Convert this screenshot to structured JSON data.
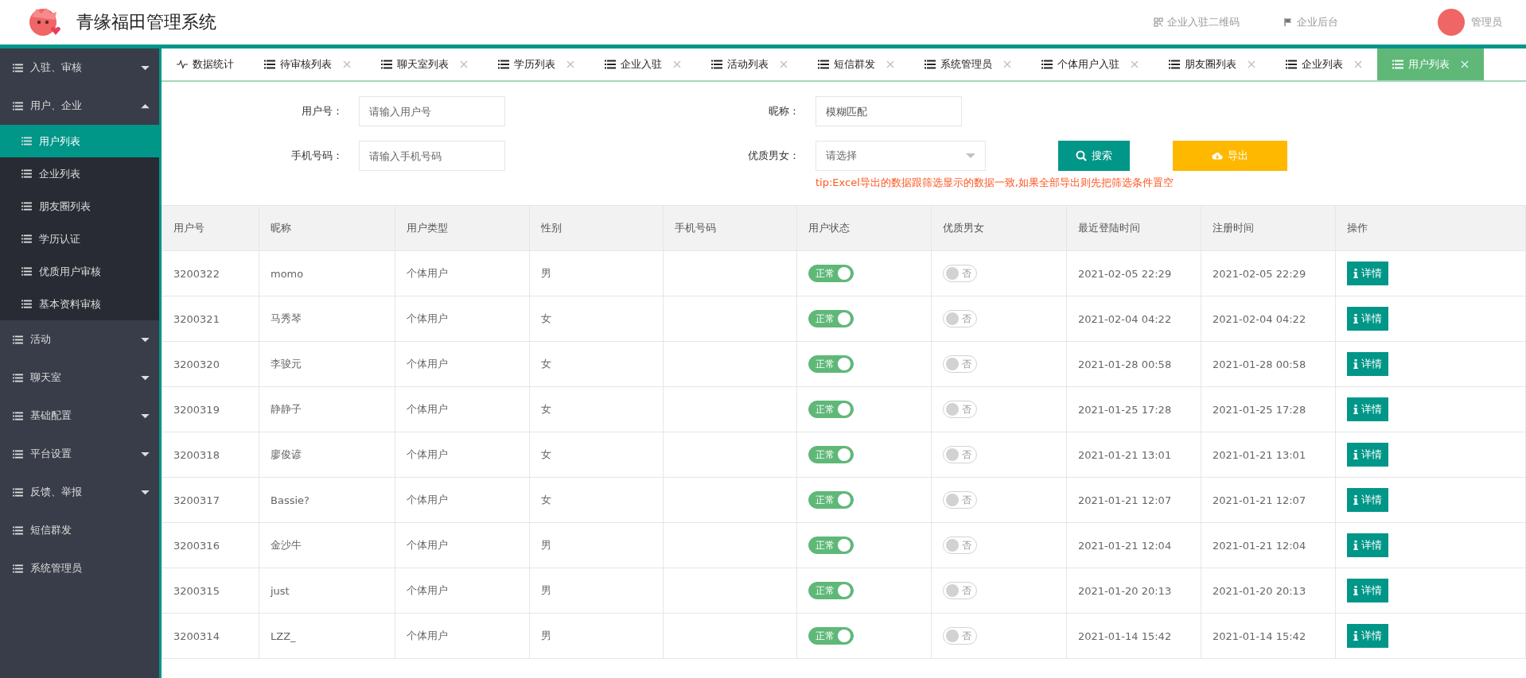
{
  "header": {
    "title": "青缘福田管理系统",
    "links": [
      {
        "kind": "qrcode",
        "label": "企业入驻二维码"
      },
      {
        "kind": "flag",
        "label": "企业后台"
      }
    ],
    "user": "管理员"
  },
  "sidebar": {
    "items": [
      {
        "label": "入驻、审核",
        "kind": "group",
        "expanded": false
      },
      {
        "label": "用户、企业",
        "kind": "group",
        "expanded": true,
        "children": [
          {
            "label": "用户列表",
            "selected": true
          },
          {
            "label": "企业列表",
            "selected": false
          },
          {
            "label": "朋友圈列表",
            "selected": false
          },
          {
            "label": "学历认证",
            "selected": false
          },
          {
            "label": "优质用户审核",
            "selected": false
          },
          {
            "label": "基本资料审核",
            "selected": false
          }
        ]
      },
      {
        "label": "活动",
        "kind": "group",
        "expanded": false
      },
      {
        "label": "聊天室",
        "kind": "group",
        "expanded": false
      },
      {
        "label": "基础配置",
        "kind": "group",
        "expanded": false
      },
      {
        "label": "平台设置",
        "kind": "group",
        "expanded": false
      },
      {
        "label": "反馈、举报",
        "kind": "group",
        "expanded": false
      },
      {
        "label": "短信群发",
        "kind": "link"
      },
      {
        "label": "系统管理员",
        "kind": "link"
      }
    ]
  },
  "tabs": [
    {
      "label": "数据统计",
      "kind": "home",
      "selected": false
    },
    {
      "label": "待审核列表",
      "kind": "page",
      "selected": false
    },
    {
      "label": "聊天室列表",
      "kind": "page",
      "selected": false
    },
    {
      "label": "学历列表",
      "kind": "page",
      "selected": false
    },
    {
      "label": "企业入驻",
      "kind": "page",
      "selected": false
    },
    {
      "label": "活动列表",
      "kind": "page",
      "selected": false
    },
    {
      "label": "短信群发",
      "kind": "page",
      "selected": false
    },
    {
      "label": "系统管理员",
      "kind": "page",
      "selected": false
    },
    {
      "label": "个体用户入驻",
      "kind": "page",
      "selected": false
    },
    {
      "label": "朋友圈列表",
      "kind": "page",
      "selected": false
    },
    {
      "label": "企业列表",
      "kind": "page",
      "selected": false
    },
    {
      "label": "用户列表",
      "kind": "page",
      "selected": true
    }
  ],
  "filters": {
    "user_id": {
      "label": "用户号：",
      "placeholder": "请输入用户号"
    },
    "nickname": {
      "label": "昵称：",
      "placeholder": "模糊匹配"
    },
    "phone": {
      "label": "手机号码：",
      "placeholder": "请输入手机号码"
    },
    "premium": {
      "label": "优质男女：",
      "placeholder": "请选择"
    },
    "search_button": "搜索",
    "export_button": "导出",
    "tip": "tip:Excel导出的数据跟筛选显示的数据一致,如果全部导出则先把筛选条件置空"
  },
  "table": {
    "columns": [
      "用户号",
      "昵称",
      "用户类型",
      "性别",
      "手机号码",
      "用户状态",
      "优质男女",
      "最近登陆时间",
      "注册时间",
      "操作"
    ],
    "rows": [
      {
        "id": "3200322",
        "nickname": "momo",
        "type": "个体用户",
        "gender": "男",
        "phone": "",
        "status": {
          "on": true,
          "label": "正常"
        },
        "premium": {
          "on": false,
          "label": "否"
        },
        "last_login": "2021-02-05 22:29",
        "registered": "2021-02-05 22:29",
        "action": "详情"
      },
      {
        "id": "3200321",
        "nickname": "马秀琴",
        "type": "个体用户",
        "gender": "女",
        "phone": "",
        "status": {
          "on": true,
          "label": "正常"
        },
        "premium": {
          "on": false,
          "label": "否"
        },
        "last_login": "2021-02-04 04:22",
        "registered": "2021-02-04 04:22",
        "action": "详情"
      },
      {
        "id": "3200320",
        "nickname": "李骏元",
        "type": "个体用户",
        "gender": "女",
        "phone": "",
        "status": {
          "on": true,
          "label": "正常"
        },
        "premium": {
          "on": false,
          "label": "否"
        },
        "last_login": "2021-01-28 00:58",
        "registered": "2021-01-28 00:58",
        "action": "详情"
      },
      {
        "id": "3200319",
        "nickname": "静静子",
        "type": "个体用户",
        "gender": "女",
        "phone": "",
        "status": {
          "on": true,
          "label": "正常"
        },
        "premium": {
          "on": false,
          "label": "否"
        },
        "last_login": "2021-01-25 17:28",
        "registered": "2021-01-25 17:28",
        "action": "详情"
      },
      {
        "id": "3200318",
        "nickname": "廖俊谚",
        "type": "个体用户",
        "gender": "女",
        "phone": "",
        "status": {
          "on": true,
          "label": "正常"
        },
        "premium": {
          "on": false,
          "label": "否"
        },
        "last_login": "2021-01-21 13:01",
        "registered": "2021-01-21 13:01",
        "action": "详情"
      },
      {
        "id": "3200317",
        "nickname": "Bassie?",
        "type": "个体用户",
        "gender": "女",
        "phone": "",
        "status": {
          "on": true,
          "label": "正常"
        },
        "premium": {
          "on": false,
          "label": "否"
        },
        "last_login": "2021-01-21 12:07",
        "registered": "2021-01-21 12:07",
        "action": "详情"
      },
      {
        "id": "3200316",
        "nickname": "金沙牛",
        "type": "个体用户",
        "gender": "男",
        "phone": "",
        "status": {
          "on": true,
          "label": "正常"
        },
        "premium": {
          "on": false,
          "label": "否"
        },
        "last_login": "2021-01-21 12:04",
        "registered": "2021-01-21 12:04",
        "action": "详情"
      },
      {
        "id": "3200315",
        "nickname": "just",
        "type": "个体用户",
        "gender": "男",
        "phone": "",
        "status": {
          "on": true,
          "label": "正常"
        },
        "premium": {
          "on": false,
          "label": "否"
        },
        "last_login": "2021-01-20 20:13",
        "registered": "2021-01-20 20:13",
        "action": "详情"
      },
      {
        "id": "3200314",
        "nickname": "LZZ_",
        "type": "个体用户",
        "gender": "男",
        "phone": "",
        "status": {
          "on": true,
          "label": "正常"
        },
        "premium": {
          "on": false,
          "label": "否"
        },
        "last_login": "2021-01-14 15:42",
        "registered": "2021-01-14 15:42",
        "action": "详情"
      }
    ]
  }
}
